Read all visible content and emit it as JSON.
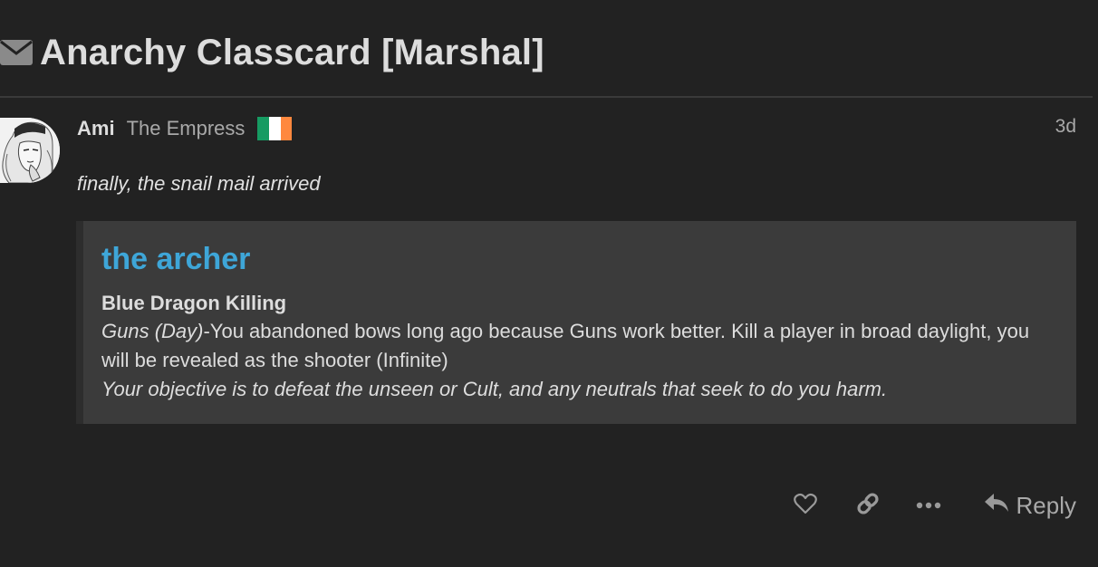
{
  "topic": {
    "title": "Anarchy Classcard [Marshal]",
    "icon": "envelope-icon"
  },
  "post": {
    "username": "Ami",
    "user_title": "The Empress",
    "flag": {
      "name": "ireland-flag-icon",
      "colors": [
        "#169b62",
        "#ffffff",
        "#ff883e"
      ]
    },
    "date": "3d",
    "body": "finally, the snail mail arrived",
    "quote": {
      "heading": "the archer",
      "subheading": "Blue Dragon Killing",
      "ability_name": "Guns (Day)",
      "ability_text": "-You abandoned bows long ago because Guns work better. Kill a player in broad daylight, you will be revealed as the shooter (Infinite)",
      "objective": "Your objective is to defeat the unseen or Cult, and any neutrals that seek to do you harm."
    }
  },
  "actions": {
    "like_icon": "heart-icon",
    "link_icon": "link-icon",
    "more_icon": "ellipsis-icon",
    "reply_label": "Reply"
  },
  "colors": {
    "background": "#222222",
    "accent": "#3ea6d8",
    "quote_background": "#3b3b3b"
  }
}
